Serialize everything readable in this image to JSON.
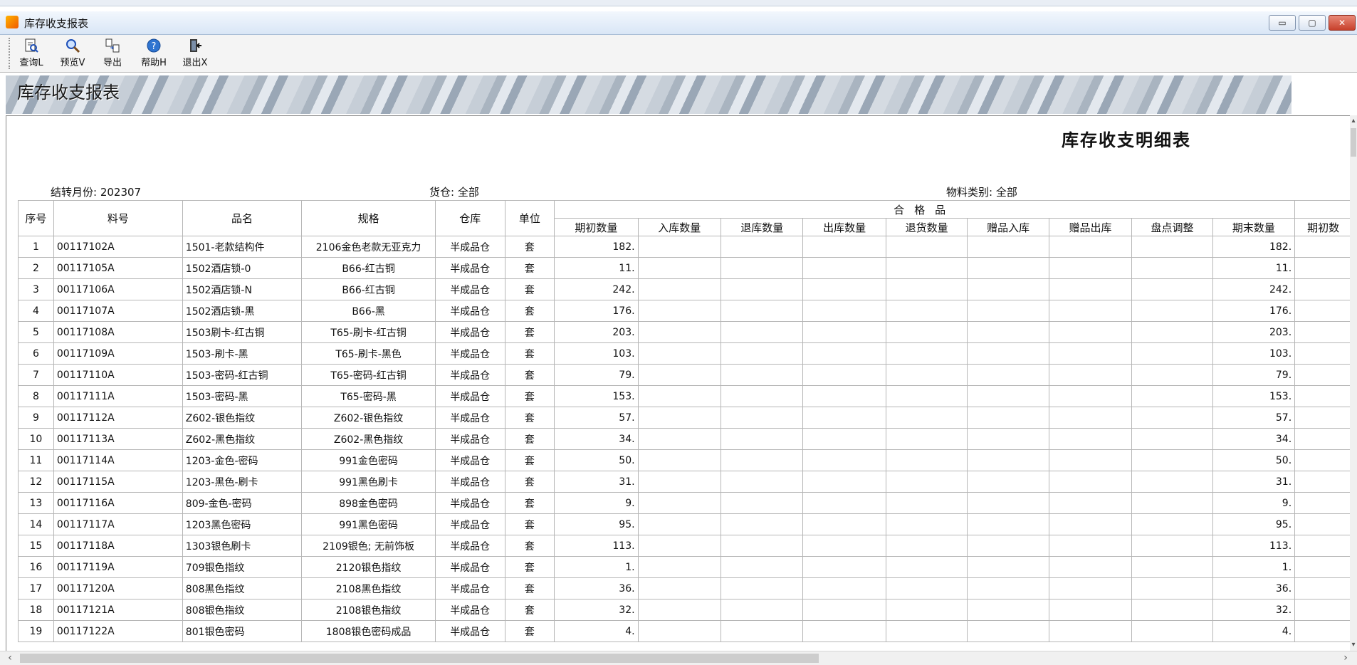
{
  "window": {
    "title": "库存收支报表",
    "controls": {
      "minimize": "▭",
      "maximize": "▢",
      "close": "✕"
    }
  },
  "toolbar": {
    "items": [
      {
        "label": "查询L",
        "icon": "query-document-icon"
      },
      {
        "label": "预览V",
        "icon": "magnifier-preview-icon"
      },
      {
        "label": "导出",
        "icon": "export-icon"
      },
      {
        "label": "帮助H",
        "icon": "help-icon"
      },
      {
        "label": "退出X",
        "icon": "exit-door-icon"
      }
    ]
  },
  "banner": {
    "title": "库存收支报表"
  },
  "report": {
    "title": "库存收支明细表",
    "meta": {
      "period": "结转月份: 202307",
      "warehouse": "货仓: 全部",
      "category": "物料类别:  全部"
    },
    "columns": {
      "seq": "序号",
      "code": "料号",
      "name": "品名",
      "spec": "规格",
      "warehouse": "仓库",
      "unit": "单位",
      "group": "合格品",
      "sub": [
        "期初数量",
        "入库数量",
        "退库数量",
        "出库数量",
        "退货数量",
        "赠品入库",
        "赠品出库",
        "盘点调整",
        "期末数量",
        "期初数"
      ]
    },
    "rows": [
      {
        "seq": "1",
        "code": "00117102A",
        "name": "1501-老款结构件",
        "spec": "2106金色老款无亚克力",
        "warehouse": "半成品仓",
        "unit": "套",
        "opening": "182.",
        "closing": "182."
      },
      {
        "seq": "2",
        "code": "00117105A",
        "name": "1502酒店锁-0",
        "spec": "B66-红古铜",
        "warehouse": "半成品仓",
        "unit": "套",
        "opening": "11.",
        "closing": "11."
      },
      {
        "seq": "3",
        "code": "00117106A",
        "name": "1502酒店锁-N",
        "spec": "B66-红古铜",
        "warehouse": "半成品仓",
        "unit": "套",
        "opening": "242.",
        "closing": "242."
      },
      {
        "seq": "4",
        "code": "00117107A",
        "name": "1502酒店锁-黑",
        "spec": "B66-黑",
        "warehouse": "半成品仓",
        "unit": "套",
        "opening": "176.",
        "closing": "176."
      },
      {
        "seq": "5",
        "code": "00117108A",
        "name": "1503刷卡-红古铜",
        "spec": "T65-刷卡-红古铜",
        "warehouse": "半成品仓",
        "unit": "套",
        "opening": "203.",
        "closing": "203."
      },
      {
        "seq": "6",
        "code": "00117109A",
        "name": "1503-刷卡-黑",
        "spec": "T65-刷卡-黑色",
        "warehouse": "半成品仓",
        "unit": "套",
        "opening": "103.",
        "closing": "103."
      },
      {
        "seq": "7",
        "code": "00117110A",
        "name": "1503-密码-红古铜",
        "spec": "T65-密码-红古铜",
        "warehouse": "半成品仓",
        "unit": "套",
        "opening": "79.",
        "closing": "79."
      },
      {
        "seq": "8",
        "code": "00117111A",
        "name": "1503-密码-黑",
        "spec": "T65-密码-黑",
        "warehouse": "半成品仓",
        "unit": "套",
        "opening": "153.",
        "closing": "153."
      },
      {
        "seq": "9",
        "code": "00117112A",
        "name": "Z602-银色指纹",
        "spec": "Z602-银色指纹",
        "warehouse": "半成品仓",
        "unit": "套",
        "opening": "57.",
        "closing": "57."
      },
      {
        "seq": "10",
        "code": "00117113A",
        "name": "Z602-黑色指纹",
        "spec": "Z602-黑色指纹",
        "warehouse": "半成品仓",
        "unit": "套",
        "opening": "34.",
        "closing": "34."
      },
      {
        "seq": "11",
        "code": "00117114A",
        "name": "1203-金色-密码",
        "spec": "991金色密码",
        "warehouse": "半成品仓",
        "unit": "套",
        "opening": "50.",
        "closing": "50."
      },
      {
        "seq": "12",
        "code": "00117115A",
        "name": "1203-黑色-刷卡",
        "spec": "991黑色刷卡",
        "warehouse": "半成品仓",
        "unit": "套",
        "opening": "31.",
        "closing": "31."
      },
      {
        "seq": "13",
        "code": "00117116A",
        "name": "809-金色-密码",
        "spec": "898金色密码",
        "warehouse": "半成品仓",
        "unit": "套",
        "opening": "9.",
        "closing": "9."
      },
      {
        "seq": "14",
        "code": "00117117A",
        "name": "1203黑色密码",
        "spec": "991黑色密码",
        "warehouse": "半成品仓",
        "unit": "套",
        "opening": "95.",
        "closing": "95."
      },
      {
        "seq": "15",
        "code": "00117118A",
        "name": "1303银色刷卡",
        "spec": "2109银色; 无前饰板",
        "warehouse": "半成品仓",
        "unit": "套",
        "opening": "113.",
        "closing": "113."
      },
      {
        "seq": "16",
        "code": "00117119A",
        "name": "709银色指纹",
        "spec": "2120银色指纹",
        "warehouse": "半成品仓",
        "unit": "套",
        "opening": "1.",
        "closing": "1."
      },
      {
        "seq": "17",
        "code": "00117120A",
        "name": "808黑色指纹",
        "spec": "2108黑色指纹",
        "warehouse": "半成品仓",
        "unit": "套",
        "opening": "36.",
        "closing": "36."
      },
      {
        "seq": "18",
        "code": "00117121A",
        "name": "808银色指纹",
        "spec": "2108银色指纹",
        "warehouse": "半成品仓",
        "unit": "套",
        "opening": "32.",
        "closing": "32."
      },
      {
        "seq": "19",
        "code": "00117122A",
        "name": "801银色密码",
        "spec": "1808银色密码成品",
        "warehouse": "半成品仓",
        "unit": "套",
        "opening": "4.",
        "closing": "4."
      }
    ]
  },
  "scrollbars": {
    "up": "▴",
    "down": "▾",
    "left": "‹",
    "right": "›"
  }
}
